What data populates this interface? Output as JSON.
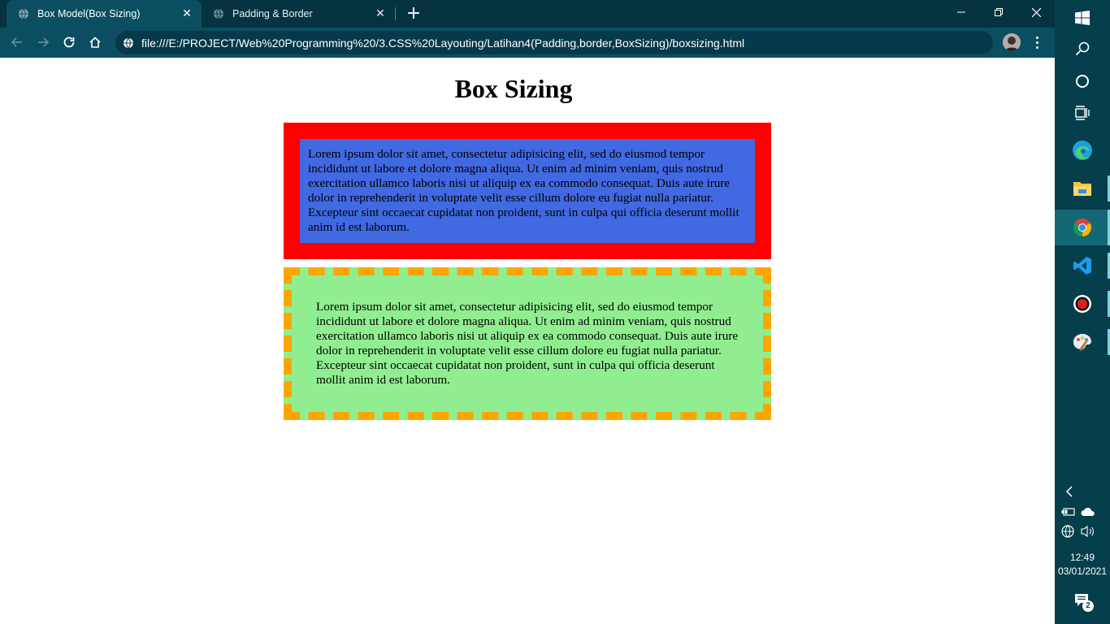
{
  "browser": {
    "tabs": [
      {
        "title": "Box Model(Box Sizing)",
        "active": true
      },
      {
        "title": "Padding & Border",
        "active": false
      }
    ],
    "url": "file:///E:/PROJECT/Web%20Programming%20/3.CSS%20Layouting/Latihan4(Padding,border,BoxSizing)/boxsizing.html",
    "icons": {
      "back": "arrow-left-icon",
      "forward": "arrow-right-icon",
      "reload": "reload-icon",
      "home": "home-icon",
      "site": "globe-icon",
      "menu": "kebab-menu-icon",
      "minimize": "minimize-icon",
      "restore": "restore-icon",
      "close": "close-icon"
    }
  },
  "page": {
    "title": "Box Sizing",
    "box1": {
      "text": "Lorem ipsum dolor sit amet, consectetur adipisicing elit, sed do eiusmod tempor incididunt ut labore et dolore magna aliqua. Ut enim ad minim veniam, quis nostrud exercitation ullamco laboris nisi ut aliquip ex ea commodo consequat. Duis aute irure dolor in reprehenderit in voluptate velit esse cillum dolore eu fugiat nulla pariatur. Excepteur sint occaecat cupidatat non proident, sunt in culpa qui officia deserunt mollit anim id est laborum.",
      "border_color": "#ff0000",
      "background": "#4169e1"
    },
    "box2": {
      "text": "Lorem ipsum dolor sit amet, consectetur adipisicing elit, sed do eiusmod tempor incididunt ut labore et dolore magna aliqua. Ut enim ad minim veniam, quis nostrud exercitation ullamco laboris nisi ut aliquip ex ea commodo consequat. Duis aute irure dolor in reprehenderit in voluptate velit esse cillum dolore eu fugiat nulla pariatur. Excepteur sint occaecat cupidatat non proident, sunt in culpa qui officia deserunt mollit anim id est laborum.",
      "border_color": "#ffa500",
      "background": "#90ee90"
    }
  },
  "taskbar": {
    "apps": [
      "start-icon",
      "search-icon",
      "cortana-icon",
      "task-view-icon",
      "edge-icon",
      "file-explorer-icon",
      "chrome-icon",
      "vscode-icon",
      "recorder-icon",
      "paint-icon"
    ],
    "clock": {
      "time": "12:49",
      "date": "03/01/2021"
    },
    "notification_count": "2"
  }
}
